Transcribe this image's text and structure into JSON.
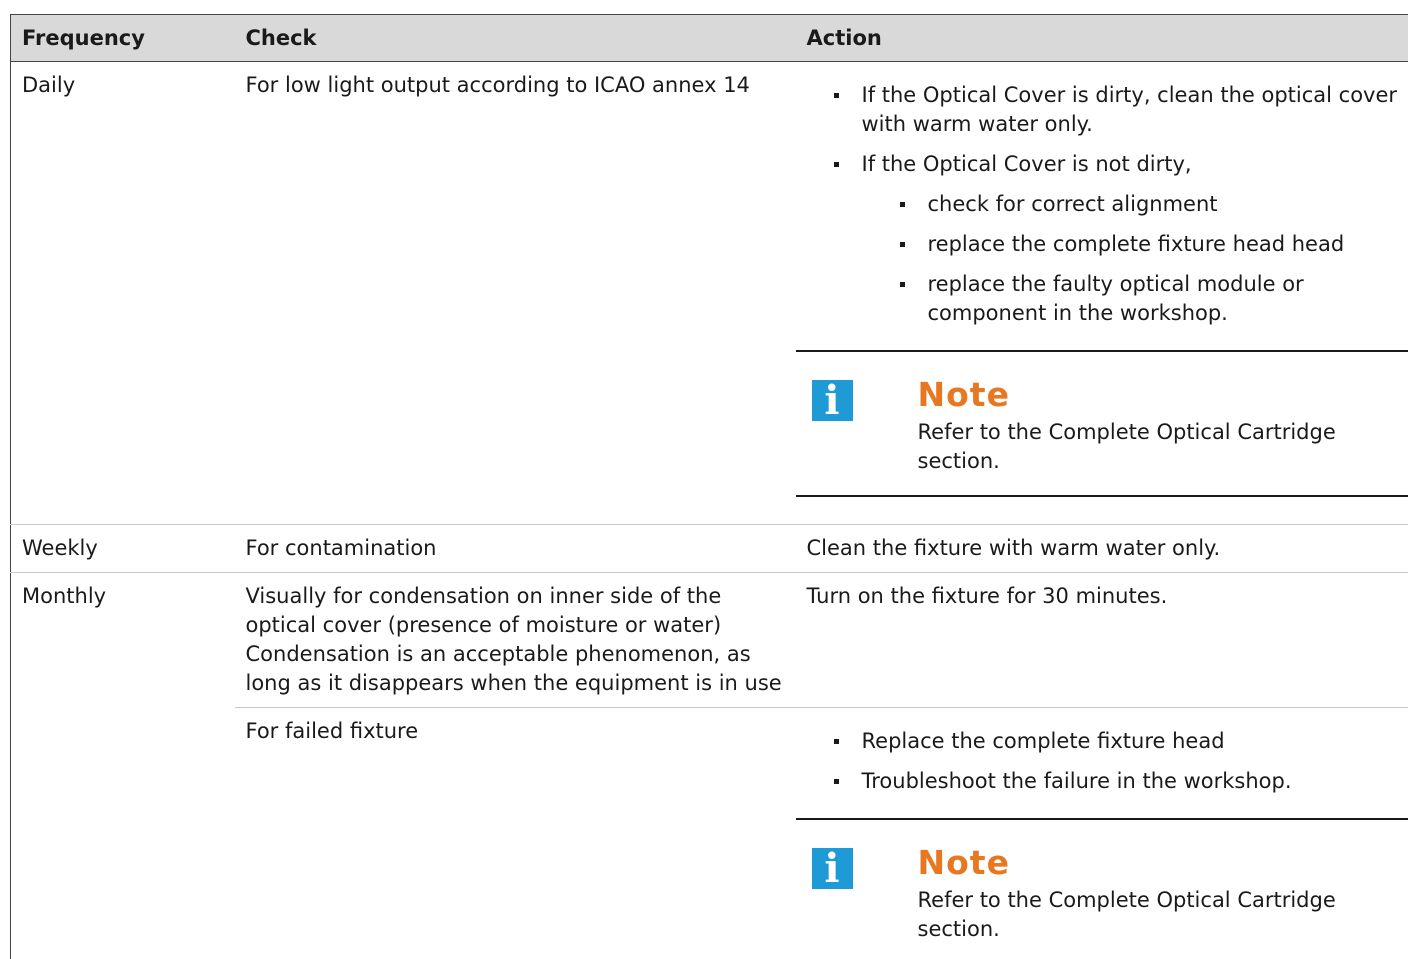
{
  "table": {
    "headers": {
      "frequency": "Frequency",
      "check": "Check",
      "action": "Action"
    },
    "rows": [
      {
        "frequency": "Daily",
        "check": "For low light output according to ICAO annex 14",
        "action_items": [
          "If the Optical Cover is dirty, clean the optical cover with warm water only.",
          "If the Optical Cover is not dirty,"
        ],
        "action_subitems": [
          "check for correct alignment",
          "replace the complete fixture head head",
          "replace the faulty optical module or component in the workshop."
        ],
        "note": {
          "title": "Note",
          "text": "Refer to the Complete Optical Cartridge section."
        }
      },
      {
        "frequency": "Weekly",
        "check": "For contamination",
        "action": "Clean the fixture with warm water only."
      },
      {
        "frequency": "Monthly",
        "check": "Visually for condensation on inner side of the optical cover (presence of moisture or water) Condensation is an acceptable phenomenon, as long as it disappears when the equipment is in use",
        "action": "Turn on the fixture for 30 minutes."
      },
      {
        "frequency": "",
        "check": "For failed fixture",
        "action_items": [
          "Replace the complete fixture head",
          "Troubleshoot the failure in the workshop."
        ],
        "note": {
          "title": "Note",
          "text": "Refer to the Complete Optical Cartridge section."
        }
      }
    ]
  },
  "colors": {
    "header_bg": "#d9d9d9",
    "note_title": "#e87722",
    "info_icon_bg": "#1e9ad6"
  },
  "icons": {
    "note_icon": "info-icon"
  }
}
